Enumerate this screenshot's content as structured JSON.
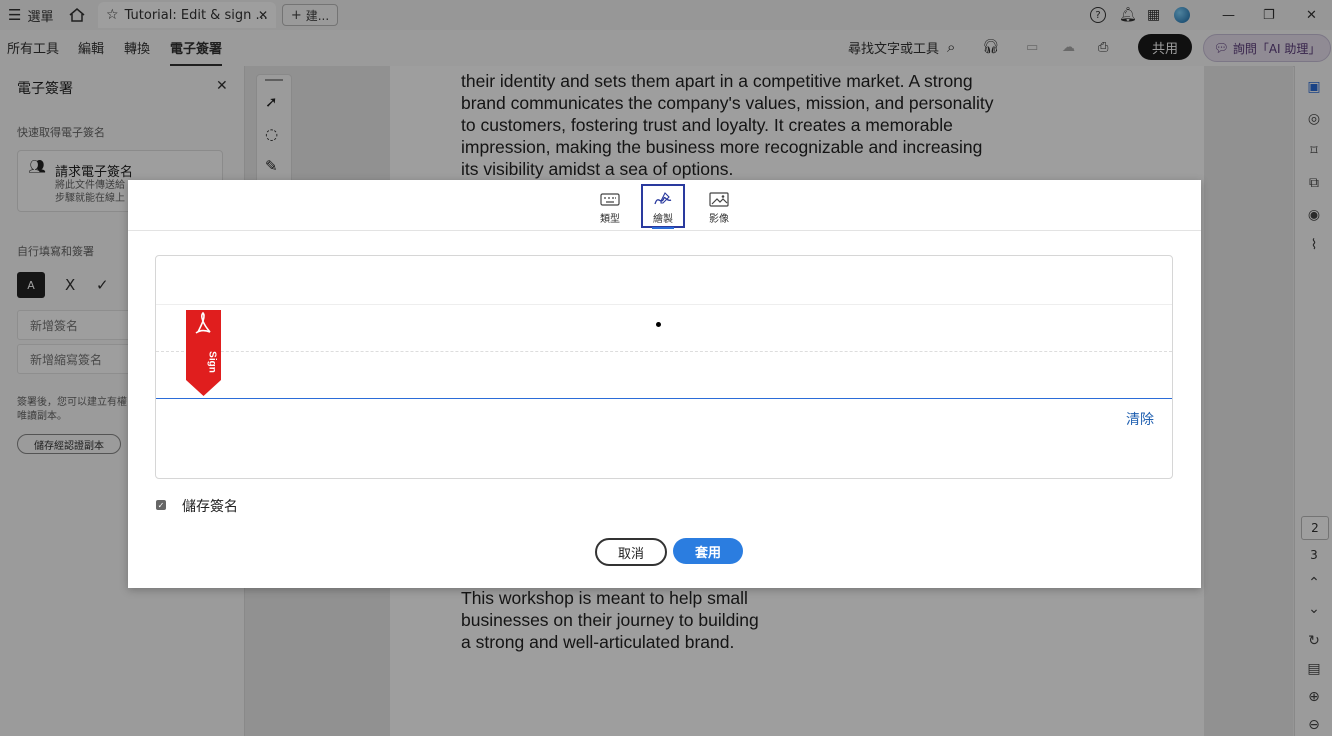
{
  "titlebar": {
    "menu_label": "選單",
    "tab_title": "Tutorial: Edit & sign ...",
    "new_tab_label": "建..."
  },
  "menubar": {
    "items": [
      "所有工具",
      "編輯",
      "轉換",
      "電子簽署"
    ],
    "find_label": "尋找文字或工具",
    "share_label": "共用",
    "ai_label": "詢問「AI 助理」"
  },
  "leftpanel": {
    "title": "電子簽署",
    "quick_label": "快速取得電子簽名",
    "request": {
      "title": "請求電子簽名",
      "desc_line1": "將此文件傳送給",
      "desc_line2": "步驟就能在線上"
    },
    "self_sign_label": "自行填寫和簽署",
    "add_signature": "新增簽名",
    "add_initials": "新增縮寫簽名",
    "note_line1": "簽署後，您可以建立有權",
    "note_line2": "唯讀副本。",
    "save_cert_label": "儲存經認證副本",
    "tool_x": "X",
    "tool_check": "✓",
    "tool_ai": "A"
  },
  "document": {
    "top_lines": [
      "their identity and sets them apart in a competitive market. A strong",
      "brand communicates the company's values, mission, and personality",
      "to customers, fostering trust and loyalty. It creates a memorable",
      "impression, making the business more recognizable and increasing",
      "its visibility amidst a sea of options."
    ],
    "bottom_lines": [
      "This workshop is meant to help small",
      "businesses on their journey to building",
      "a strong and well-articulated brand."
    ]
  },
  "rightrail": {
    "pages": [
      "2",
      "3"
    ]
  },
  "dialog": {
    "tabs": [
      "類型",
      "繪製",
      "影像"
    ],
    "selected_tab": "繪製",
    "sign_tag_text": "Sign",
    "clear_label": "清除",
    "save_signature_label": "儲存簽名",
    "save_signature_checked": true,
    "cancel_label": "取消",
    "apply_label": "套用"
  },
  "colors": {
    "accent_blue": "#2b7de0",
    "adobe_red": "#e01e1e",
    "selected_outline": "#2a3a9e"
  }
}
